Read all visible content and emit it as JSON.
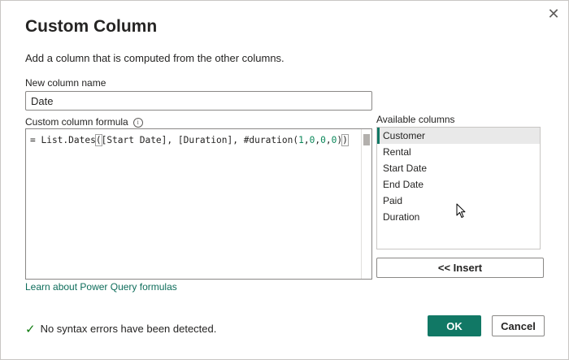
{
  "dialog": {
    "title": "Custom Column",
    "subtitle": "Add a column that is computed from the other columns.",
    "close_glyph": "✕"
  },
  "name_field": {
    "label": "New column name",
    "value": "Date"
  },
  "formula": {
    "label": "Custom column formula",
    "info_glyph": "i",
    "prefix": "= List.Dates",
    "open_paren": "(",
    "args": "[Start Date], [Duration], #duration(",
    "n1": "1",
    "c1": ",",
    "n2": "0",
    "c2": ",",
    "n3": "0",
    "c3": ",",
    "n4": "0",
    "inner_close": ")",
    "close_paren": ")"
  },
  "available_columns": {
    "label": "Available columns",
    "items": [
      "Customer",
      "Rental",
      "Start Date",
      "End Date",
      "Paid",
      "Duration"
    ],
    "selected_index": 0
  },
  "insert_button": "<< Insert",
  "learn_link": "Learn about Power Query formulas",
  "status": {
    "icon": "check-icon",
    "text": "No syntax errors have been detected."
  },
  "buttons": {
    "ok": "OK",
    "cancel": "Cancel"
  },
  "colors": {
    "accent": "#117865",
    "link": "#0e6d5b",
    "success": "#107c10",
    "number": "#098658"
  }
}
